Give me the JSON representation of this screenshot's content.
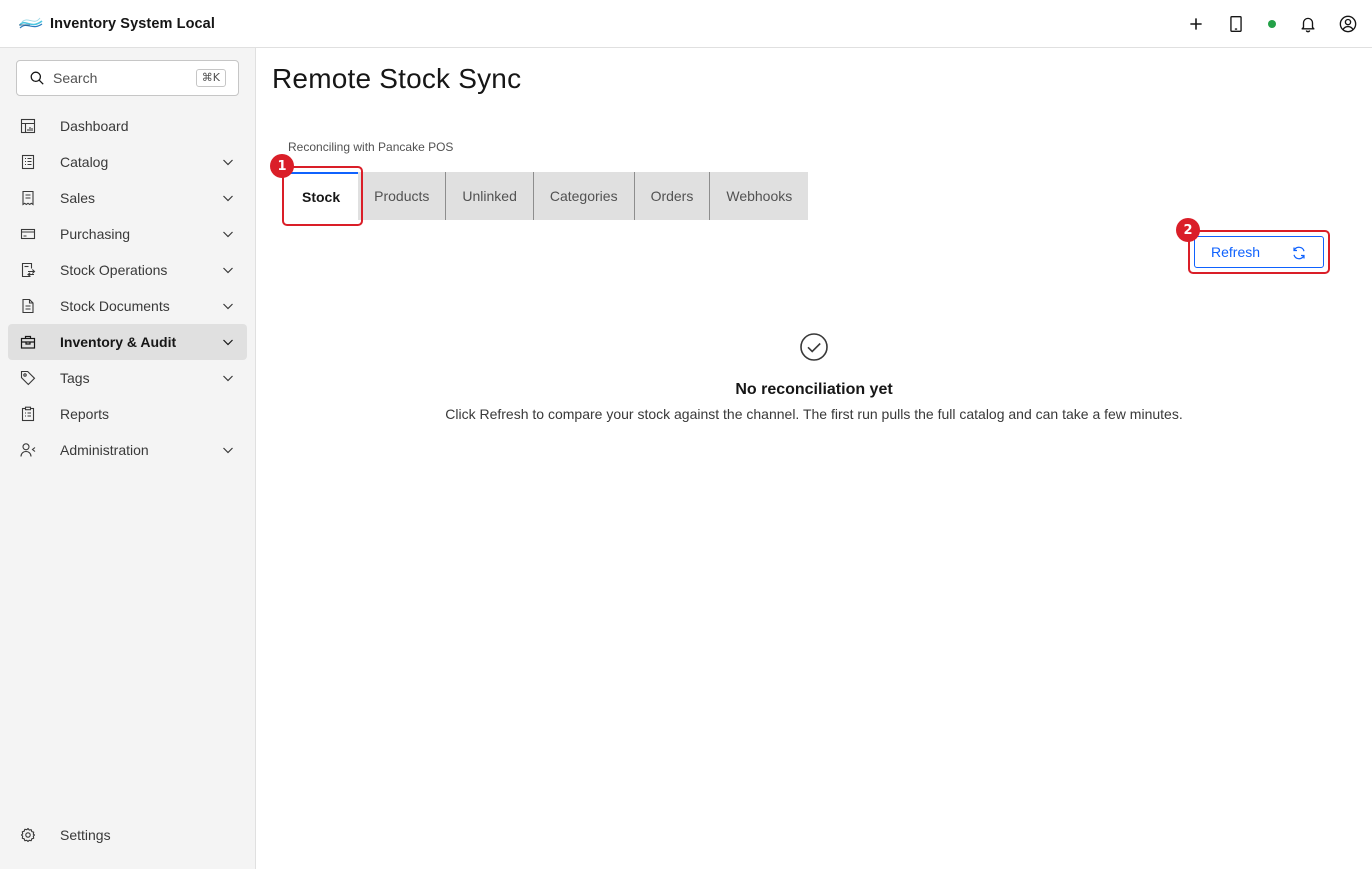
{
  "header": {
    "app_name": "Inventory System Local",
    "icons": [
      "add-icon",
      "tablet-icon",
      "status-dot",
      "notification-icon",
      "user-avatar-icon"
    ],
    "status_color": "#24a148"
  },
  "sidebar": {
    "search": {
      "placeholder": "Search",
      "shortcut": "⌘K"
    },
    "items": [
      {
        "label": "Dashboard",
        "icon": "dashboard-icon",
        "expandable": false
      },
      {
        "label": "Catalog",
        "icon": "catalog-icon",
        "expandable": true
      },
      {
        "label": "Sales",
        "icon": "sales-icon",
        "expandable": true
      },
      {
        "label": "Purchasing",
        "icon": "purchasing-icon",
        "expandable": true
      },
      {
        "label": "Stock Operations",
        "icon": "stock-operations-icon",
        "expandable": true
      },
      {
        "label": "Stock Documents",
        "icon": "stock-documents-icon",
        "expandable": true
      },
      {
        "label": "Inventory & Audit",
        "icon": "inventory-audit-icon",
        "expandable": true,
        "active": true
      },
      {
        "label": "Tags",
        "icon": "tag-icon",
        "expandable": true
      },
      {
        "label": "Reports",
        "icon": "reports-icon",
        "expandable": false
      },
      {
        "label": "Administration",
        "icon": "administration-icon",
        "expandable": true
      }
    ],
    "settings": {
      "label": "Settings",
      "icon": "settings-icon"
    }
  },
  "main": {
    "title": "Remote Stock Sync",
    "subtitle": "Reconciling with Pancake POS",
    "tabs": [
      {
        "label": "Stock",
        "selected": true
      },
      {
        "label": "Products"
      },
      {
        "label": "Unlinked"
      },
      {
        "label": "Categories"
      },
      {
        "label": "Orders"
      },
      {
        "label": "Webhooks"
      }
    ],
    "refresh_label": "Refresh",
    "empty_state": {
      "title": "No reconciliation yet",
      "description": "Click Refresh to compare your stock against the channel. The first run pulls the full catalog and can take a few minutes."
    }
  },
  "annotations": [
    "1",
    "2"
  ],
  "colors": {
    "accent": "#0f62fe",
    "annotation": "#da1e28",
    "sidebar_bg": "#f4f4f4",
    "active_bg": "#e0e0e0"
  }
}
